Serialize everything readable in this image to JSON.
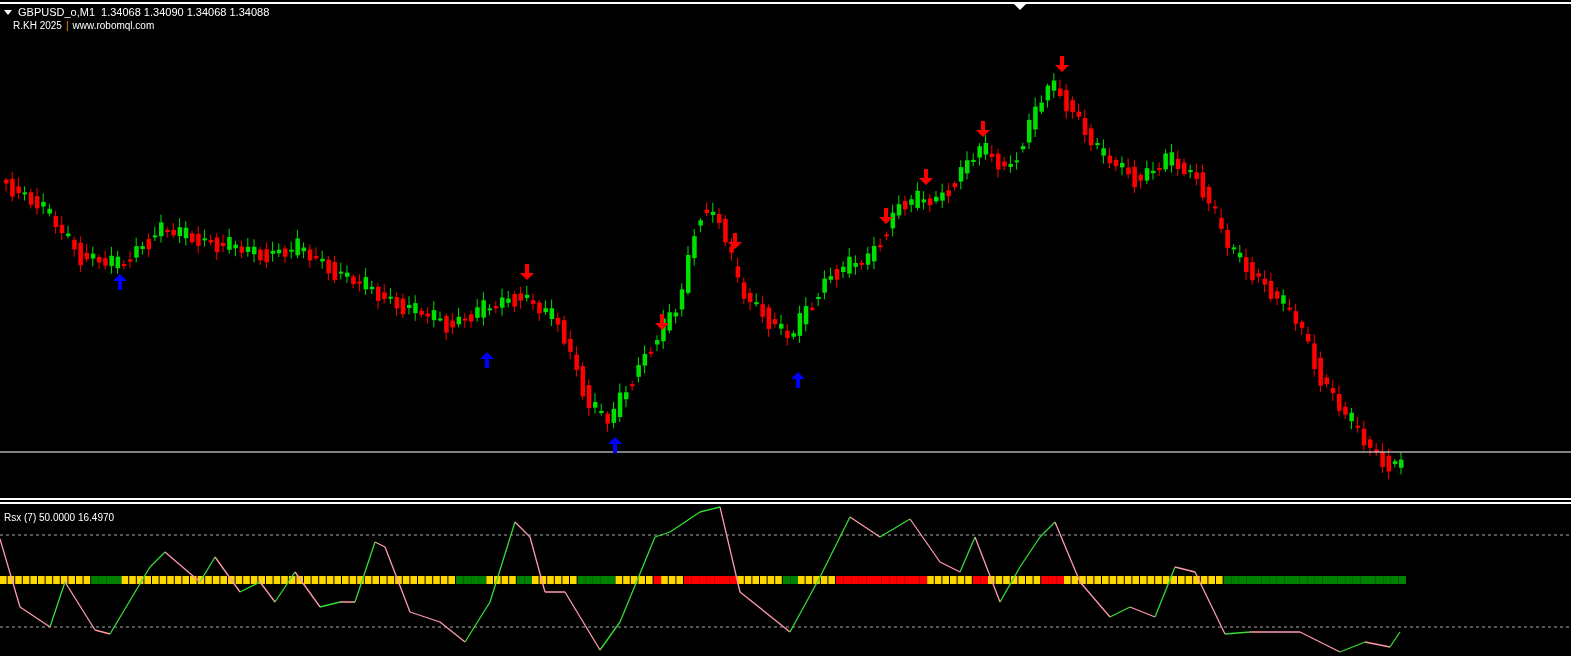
{
  "chart_header": {
    "symbol": "GBPUSD_o,M1",
    "quote": "1.34068 1.34090 1.34068 1.34088"
  },
  "credit": {
    "author": "R.KH 2025",
    "separator": "|",
    "site": "www.robomql.com"
  },
  "indicator": {
    "label": "Rsx (7) 50.0000 16.4970"
  }
}
